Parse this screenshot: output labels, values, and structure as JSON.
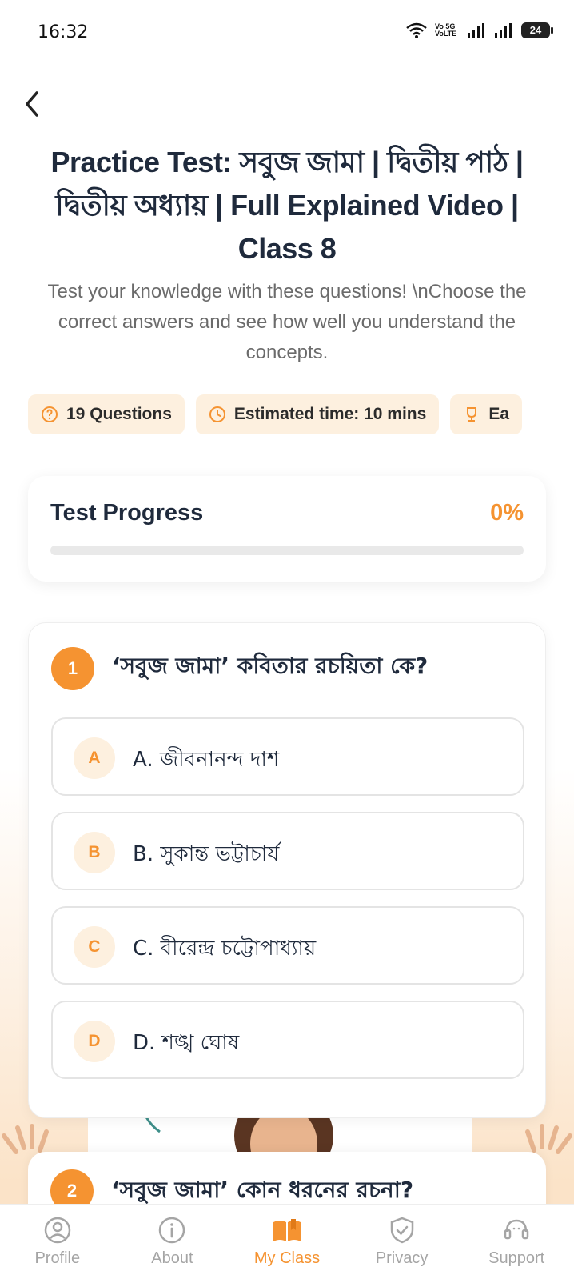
{
  "status_bar": {
    "time": "16:32",
    "network": "Vo 5G\nVoLTE",
    "battery": "24",
    "icons": [
      "wifi-icon",
      "signal-icon",
      "signal-icon",
      "battery-icon"
    ]
  },
  "header": {
    "title": "Practice Test: সবুজ জামা | দ্বিতীয় পাঠ | দ্বিতীয় অধ্যায় | Full Explained Video | Class 8",
    "subtitle": "Test your knowledge with these questions! \\nChoose the correct answers and see how well you understand the concepts."
  },
  "chips": [
    {
      "icon": "question-circle-icon",
      "label": "19 Questions"
    },
    {
      "icon": "clock-icon",
      "label": "Estimated time: 10 mins"
    },
    {
      "icon": "trophy-icon",
      "label": "Ea"
    }
  ],
  "progress": {
    "label": "Test Progress",
    "percent_text": "0%",
    "value": 0
  },
  "questions": [
    {
      "number": "1",
      "text": "‘সবুজ জামা’ কবিতার রচয়িতা কে?",
      "options": [
        {
          "letter": "A",
          "text": "A. জীবনানন্দ দাশ"
        },
        {
          "letter": "B",
          "text": "B. সুকান্ত ভট্টাচার্য"
        },
        {
          "letter": "C",
          "text": "C. বীরেন্দ্র চট্টোপাধ্যায়"
        },
        {
          "letter": "D",
          "text": "D. শঙ্খ ঘোষ"
        }
      ]
    },
    {
      "number": "2",
      "text": "‘সবুজ জামা’ কোন ধরনের রচনা?"
    }
  ],
  "bottom_nav": [
    {
      "icon": "profile-icon",
      "label": "Profile",
      "active": false
    },
    {
      "icon": "info-icon",
      "label": "About",
      "active": false
    },
    {
      "icon": "book-icon",
      "label": "My Class",
      "active": true
    },
    {
      "icon": "shield-check-icon",
      "label": "Privacy",
      "active": false
    },
    {
      "icon": "headset-icon",
      "label": "Support",
      "active": false
    }
  ],
  "colors": {
    "accent": "#f59331",
    "accent_light": "#fdf0df",
    "text_dark": "#1f2a3c",
    "text_muted": "#6b6b6b",
    "nav_inactive": "#a5a5a5"
  }
}
